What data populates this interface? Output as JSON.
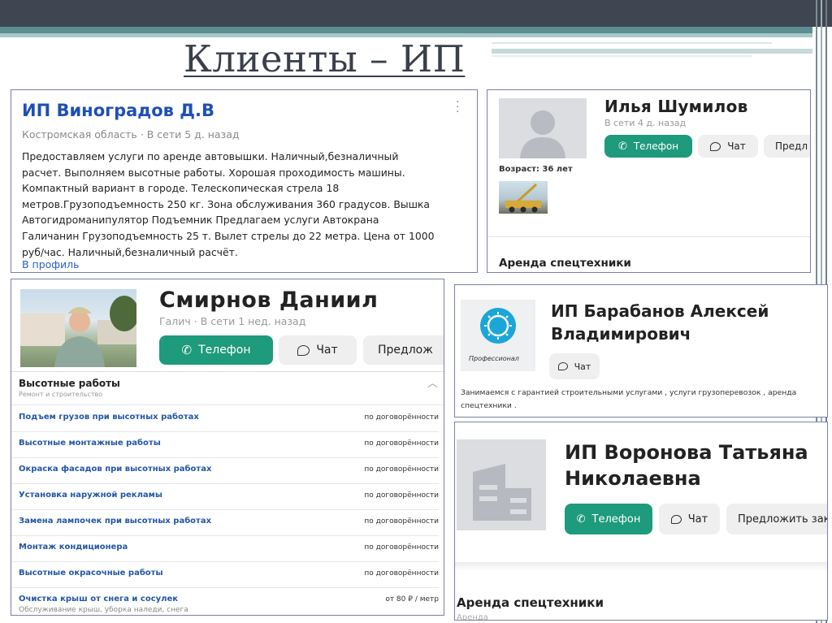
{
  "slide": {
    "title": "Клиенты – ИП"
  },
  "colors": {
    "green": "#1e9a7c",
    "link": "#2456a6",
    "title_blue": "#1f4fb5"
  },
  "card1": {
    "name": "ИП Виноградов Д.В",
    "meta": "Костромская область  ·  В сети 5 д. назад",
    "lines": [
      "Предоставляем услуги по аренде автовышки. Наличный,безналичный",
      "расчет. Выполняем высотные работы. Хорошая проходимость машины.",
      "Компактный вариант в городе. Телескопическая стрела 18",
      "метров.Грузоподъемность 250 кг. Зона обслуживания 360 градусов. Вышка",
      "Автогидроманипулятор Подъемник Предлагаем услуги Автокрана",
      "Галичанин Грузоподъемность 25 т. Вылет стрелы до 22 метра. Цена от 1000",
      "руб/час. Наличный,безналичный расчёт."
    ],
    "link": "В профиль",
    "menu_icon": "more-vertical-icon"
  },
  "card2": {
    "name": "Илья Шумилов",
    "meta": "В сети 4 д. назад",
    "phone": "Телефон",
    "chat": "Чат",
    "offer": "Предл",
    "age": "Возраст: 36 лет",
    "section": "Аренда спецтехники"
  },
  "card3": {
    "name": "Смирнов Даниил",
    "meta": "Галич  ·  В сети 1 нед. назад",
    "phone": "Телефон",
    "chat": "Чат",
    "offer": "Предлож",
    "category": "Высотные работы",
    "subcategory": "Ремонт и строительство",
    "services": [
      {
        "name": "Подъем грузов при высотных работах",
        "price": "по договорённости"
      },
      {
        "name": "Высотные монтажные работы",
        "price": "по договорённости"
      },
      {
        "name": "Окраска фасадов при высотных работах",
        "price": "по договорённости"
      },
      {
        "name": "Установка наружной рекламы",
        "price": "по договорённости"
      },
      {
        "name": "Замена лампочек при высотных работах",
        "price": "по договорённости"
      },
      {
        "name": "Монтаж кондиционера",
        "price": "по договорённости"
      },
      {
        "name": "Высотные окрасочные работы",
        "price": "по договорённости"
      },
      {
        "name": "Очистка крыш от снега и сосулек",
        "price": "от 80 ₽ / метр"
      }
    ],
    "cut_line": "Обслуживание крыш, уборка наледи, снега"
  },
  "card4": {
    "name_line1": "ИП Барабанов Алексей",
    "name_line2": "Владимирович",
    "logo_text": "Профессионал",
    "chat": "Чат",
    "desc_line1": "Занимаемся с гарантией строительными услугами , услуги грузоперевозок , аренда",
    "desc_line2": "спецтехники ."
  },
  "card5": {
    "name_line1": "ИП Воронова Татьяна",
    "name_line2": "Николаевна",
    "phone": "Телефон",
    "chat": "Чат",
    "offer": "Предложить зака",
    "section": "Аренда спецтехники",
    "section_sub": "Аренда"
  }
}
